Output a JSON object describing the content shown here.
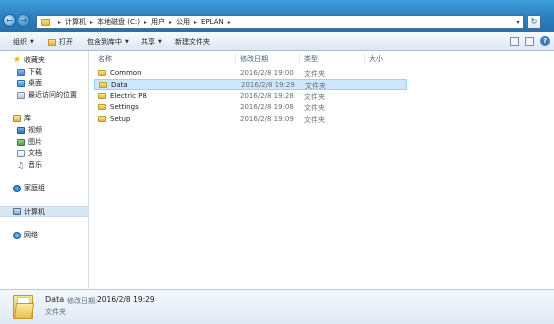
{
  "address_bar": {
    "crumbs": [
      "计算机",
      "本地磁盘 (C:)",
      "用户",
      "公用",
      "EPLAN"
    ]
  },
  "toolbar": {
    "organize": "组织",
    "open": "打开",
    "include_in_library": "包含到库中",
    "share": "共享",
    "new_folder": "新建文件夹"
  },
  "nav_pane": {
    "favorites": "收藏夹",
    "downloads": "下载",
    "desktop": "桌面",
    "recent": "最近访问的位置",
    "libraries": "库",
    "videos": "视频",
    "pictures": "图片",
    "documents": "文档",
    "music": "音乐",
    "homegroup": "家庭组",
    "computer": "计算机",
    "network": "网络"
  },
  "columns": {
    "name": "名称",
    "date": "修改日期",
    "type": "类型",
    "size": "大小"
  },
  "files": [
    {
      "name": "Common",
      "date": "2016/2/8 19:00",
      "type": "文件夹"
    },
    {
      "name": "Data",
      "date": "2016/2/8 19:29",
      "type": "文件夹"
    },
    {
      "name": "Electric P8",
      "date": "2016/2/8 19:28",
      "type": "文件夹"
    },
    {
      "name": "Settings",
      "date": "2016/2/8 19:08",
      "type": "文件夹"
    },
    {
      "name": "Setup",
      "date": "2016/2/8 19:09",
      "type": "文件夹"
    }
  ],
  "selected_file": "Data",
  "details": {
    "name": "Data",
    "date_label": "修改日期:",
    "date": "2016/2/8 19:29",
    "type": "文件夹"
  },
  "colors": {
    "title_gradient": "#2a7fbf",
    "selection_fill": "#cce8ff",
    "selection_border": "#99d1ff"
  }
}
